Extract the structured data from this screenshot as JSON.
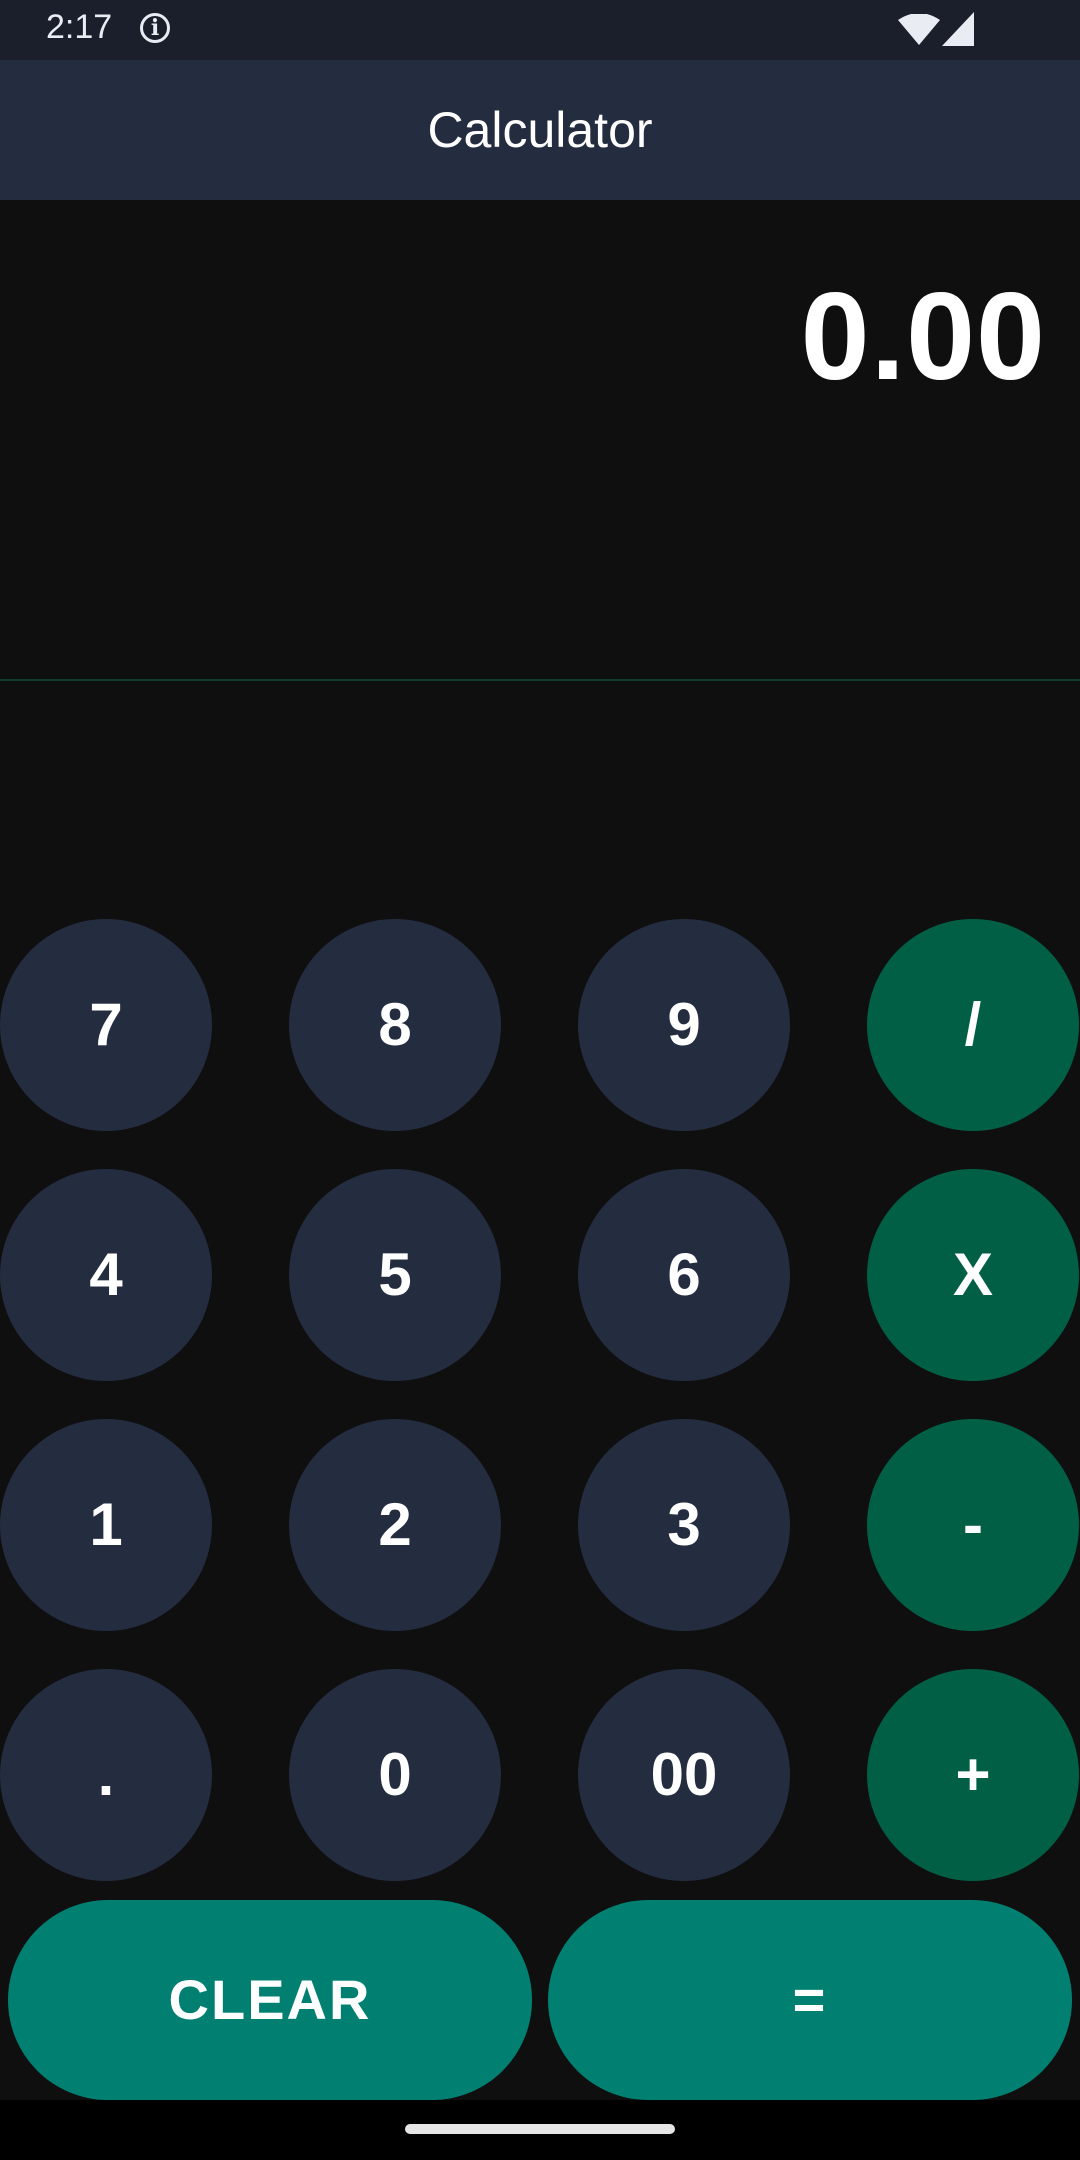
{
  "status_bar": {
    "time": "2:17",
    "info_icon": "info-icon",
    "wifi_icon": "wifi-icon",
    "signal_icon": "cell-signal-icon"
  },
  "app_bar": {
    "title": "Calculator"
  },
  "display": {
    "value": "0.00"
  },
  "keypad": {
    "rows": [
      [
        "7",
        "8",
        "9",
        "/"
      ],
      [
        "4",
        "5",
        "6",
        "X"
      ],
      [
        "1",
        "2",
        "3",
        "-"
      ],
      [
        ".",
        "0",
        "00",
        "+"
      ]
    ],
    "clear_label": "CLEAR",
    "equals_label": "="
  },
  "colors": {
    "status_bar_bg": "#1b1f2b",
    "app_bar_bg": "#242c3f",
    "background": "#0f0f10",
    "digit_key_bg": "#242c3f",
    "operator_key_bg": "#015f45",
    "action_key_bg": "#018072"
  }
}
